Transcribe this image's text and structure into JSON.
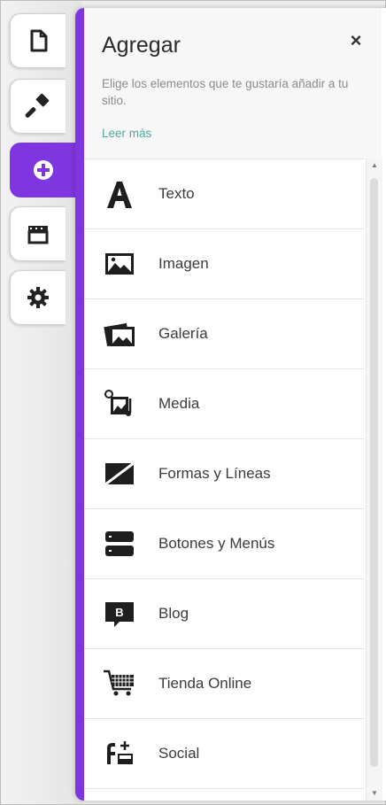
{
  "rail": {
    "tabs": [
      {
        "icon": "page-icon",
        "label": "Pages"
      },
      {
        "icon": "paint-brush-icon",
        "label": "Design"
      },
      {
        "icon": "add-circle-icon",
        "label": "Add",
        "active": true
      },
      {
        "icon": "store-icon",
        "label": "Store"
      },
      {
        "icon": "gear-icon",
        "label": "Settings"
      }
    ]
  },
  "panel": {
    "title": "Agregar",
    "close": "×",
    "description": "Elige los elementos que te gustaría añadir a tu sitio.",
    "learn_more": "Leer más",
    "accent_color": "#7f36e0",
    "link_color": "#4fa9a3"
  },
  "items": [
    {
      "label": "Texto",
      "icon": "text-icon"
    },
    {
      "label": "Imagen",
      "icon": "image-icon"
    },
    {
      "label": "Galería",
      "icon": "gallery-icon"
    },
    {
      "label": "Media",
      "icon": "media-icon"
    },
    {
      "label": "Formas y Líneas",
      "icon": "shapes-icon"
    },
    {
      "label": "Botones y Menús",
      "icon": "buttons-menus-icon"
    },
    {
      "label": "Blog",
      "icon": "blog-icon"
    },
    {
      "label": "Tienda Online",
      "icon": "cart-icon"
    },
    {
      "label": "Social",
      "icon": "social-icon"
    }
  ],
  "scrollbar": {
    "up": "▲",
    "down": "▼"
  }
}
